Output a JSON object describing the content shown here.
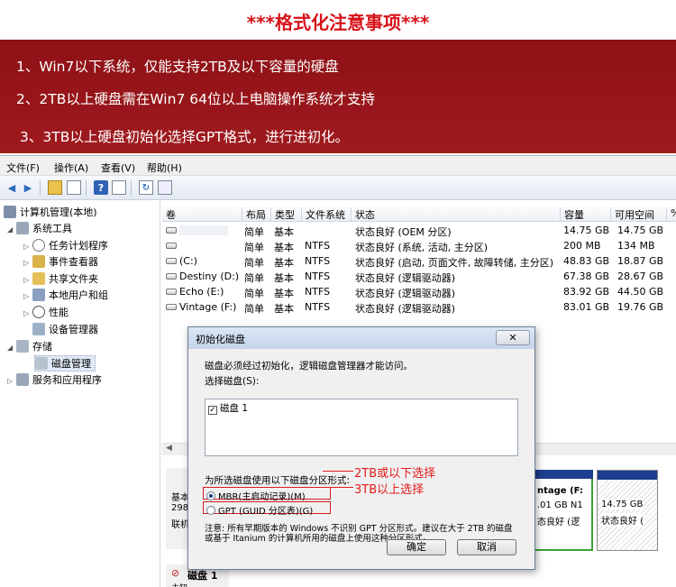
{
  "header": {
    "title": "***格式化注意事项***"
  },
  "notes": [
    "1、Win7以下系统，仅能支持2TB及以下容量的硬盘",
    "2、2TB以上硬盘需在Win7 64位以上电脑操作系统才支持",
    "3、3TB以上硬盘初始化选择GPT格式，进行进初化。"
  ],
  "menu": [
    "文件(F)",
    "操作(A)",
    "查看(V)",
    "帮助(H)"
  ],
  "tree": {
    "root": "计算机管理(本地)",
    "system_tools": "系统工具",
    "task_scheduler": "任务计划程序",
    "event_viewer": "事件查看器",
    "shared_folders": "共享文件夹",
    "local_users": "本地用户和组",
    "performance": "性能",
    "device_manager": "设备管理器",
    "storage": "存储",
    "disk_management": "磁盘管理",
    "services": "服务和应用程序"
  },
  "grid": {
    "columns": [
      "卷",
      "布局",
      "类型",
      "文件系统",
      "状态",
      "容量",
      "可用空间"
    ],
    "rows": [
      {
        "vol": "",
        "layout": "简单",
        "type": "基本",
        "fs": "",
        "status": "状态良好 (OEM 分区)",
        "cap": "14.75 GB",
        "free": "14.75 GB"
      },
      {
        "vol": "",
        "layout": "简单",
        "type": "基本",
        "fs": "NTFS",
        "status": "状态良好 (系统, 活动, 主分区)",
        "cap": "200 MB",
        "free": "134 MB"
      },
      {
        "vol": "(C:)",
        "layout": "简单",
        "type": "基本",
        "fs": "NTFS",
        "status": "状态良好 (启动, 页面文件, 故障转储, 主分区)",
        "cap": "48.83 GB",
        "free": "18.87 GB"
      },
      {
        "vol": "Destiny (D:)",
        "layout": "简单",
        "type": "基本",
        "fs": "NTFS",
        "status": "状态良好 (逻辑驱动器)",
        "cap": "67.38 GB",
        "free": "28.67 GB"
      },
      {
        "vol": "Echo (E:)",
        "layout": "简单",
        "type": "基本",
        "fs": "NTFS",
        "status": "状态良好 (逻辑驱动器)",
        "cap": "83.92 GB",
        "free": "44.50 GB"
      },
      {
        "vol": "Vintage (F:)",
        "layout": "简单",
        "type": "基本",
        "fs": "NTFS",
        "status": "状态良好 (逻辑驱动器)",
        "cap": "83.01 GB",
        "free": "19.76 GB"
      }
    ]
  },
  "lower": {
    "disk0_a": "基本",
    "disk0_b": "298",
    "disk0_c": "联机",
    "vintage_title": "ntage (F:",
    "vintage_size": ".01 GB N1",
    "vintage_status": "态良好 (逻",
    "oem_size": "14.75 GB",
    "oem_status": "状态良好 (",
    "disk1_label": "磁盘 1",
    "disk1_sub": "未知"
  },
  "dialog": {
    "title": "初始化磁盘",
    "close": "✕",
    "intro": "磁盘必须经过初始化，逻辑磁盘管理器才能访问。",
    "select_label": "选择磁盘(S):",
    "disk_item": "磁盘 1",
    "partition_label": "为所选磁盘使用以下磁盘分区形式:",
    "mbr": "MBR(主启动记录)(M)",
    "gpt": "GPT (GUID 分区表)(G)",
    "note": "注意: 所有早期版本的 Windows 不识别 GPT 分区形式。建议在大于 2TB 的磁盘或基于 Itanium 的计算机所用的磁盘上使用这种分区形式。",
    "ok": "确定",
    "cancel": "取消"
  },
  "annotations": {
    "mbr": "2TB或以下选择",
    "gpt": "3TB以上选择"
  }
}
